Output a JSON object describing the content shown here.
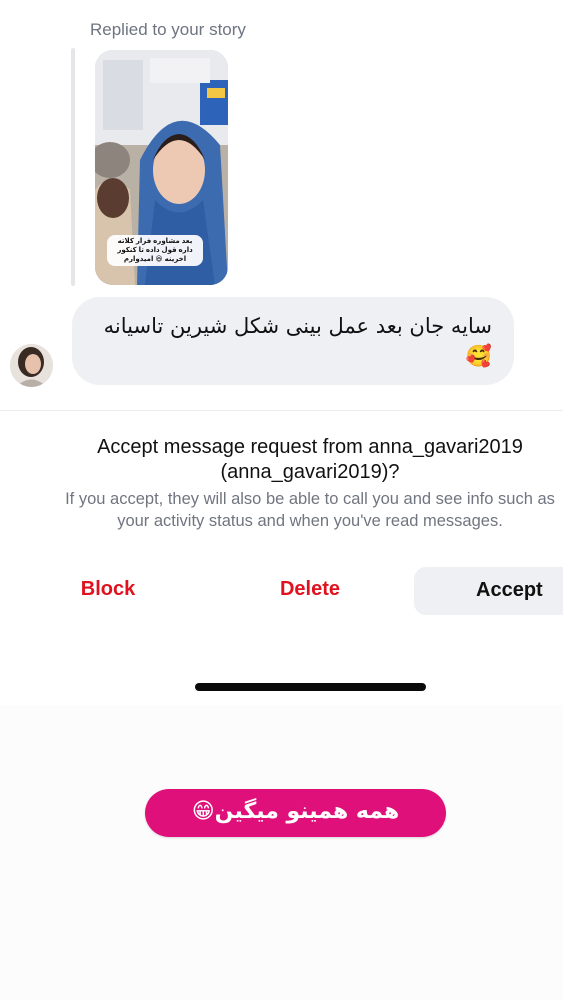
{
  "reply": {
    "label": "Replied to your story",
    "story_caption": "بعد مشاوره فرار کلاته داره قول داده تا کنکور اخرینه 😆 امیدوارم"
  },
  "message": {
    "text": "سایه جان بعد عمل بینی شکل شیرین تاسیانه",
    "emoji": "🥰"
  },
  "request": {
    "title_line1": "Accept message request from anna_gavari2019",
    "title_line2": "(anna_gavari2019)?",
    "subtitle_line1": "If you accept, they will also be able to call you and see info such as",
    "subtitle_line2": "your activity status and when you've read messages."
  },
  "actions": {
    "block": "Block",
    "delete": "Delete",
    "accept": "Accept"
  },
  "overlay": {
    "sticker_text": "همه همینو میگین😁"
  },
  "colors": {
    "danger": "#e0121f",
    "sticker": "#e0107a",
    "bubble": "#eff0f3"
  }
}
